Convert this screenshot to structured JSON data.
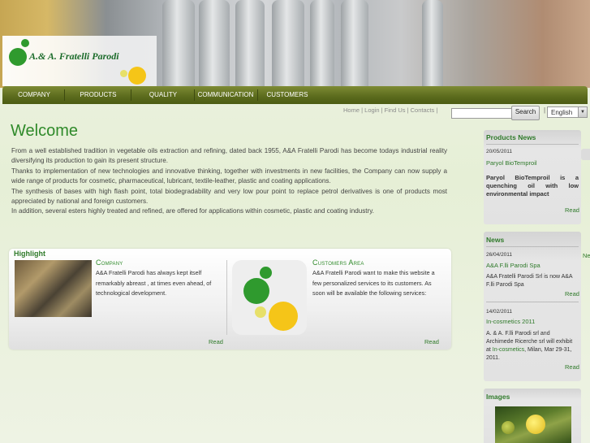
{
  "brand": {
    "logo_text": "A.& A. Fratelli Parodi",
    "colors": {
      "green": "#2f9a2e",
      "yellow": "#f5c518"
    }
  },
  "nav": {
    "items": [
      "COMPANY",
      "PRODUCTS",
      "QUALITY",
      "COMMUNICATION",
      "CUSTOMERS"
    ]
  },
  "toplinks": {
    "home": "Home",
    "login": "Login",
    "findus": "Find Us",
    "contacts": "Contacts"
  },
  "search": {
    "value": "",
    "button": "Search"
  },
  "language": {
    "selected": "English"
  },
  "welcome": {
    "title": "Welcome",
    "p1": "From a well established tradition in vegetable oils extraction and refining, dated back 1955, A&A Fratelli Parodi has become todays industrial reality diversifying its production to gain its present structure.",
    "p2": "Thanks to implementation of new technologies and innovative thinking, together with investments in new facilities, the Company can now supply a wide range of products for cosmetic, pharmaceutical, lubricant, textile-leather, plastic and coating applications.",
    "p3": "The synthesis of bases with high flash point, total biodegradability and very low pour point to replace petrol derivatives is one of products most appreciated by national and foreign customers.",
    "p4": "In addition, several esters highly treated and refined, are offered for applications within cosmetic, plastic and coating  industry."
  },
  "highlight": {
    "title": "Highlight",
    "company": {
      "heading": "Company",
      "body": "A&A Fratelli Parodi has always kept itself remarkably abreast , at times even ahead, of technological development.",
      "read": "Read"
    },
    "customers": {
      "heading": "Customers Area",
      "body": "A&A Fratelli Parodi want to make this website a few personalized services to its customers. As soon will be available the following services:",
      "read": "Read"
    }
  },
  "products_news": {
    "title": "Products News",
    "date": "20/05/2011",
    "link": "Paryol BioTemproil",
    "text": "Paryol BioTemproil is a quenching oil with low environmental impact",
    "read": "Read"
  },
  "news": {
    "title": "News",
    "items": [
      {
        "date": "26/04/2011",
        "link": "A&A F.lli Parodi Spa",
        "text": "A&A Fratelli Parodi Srl is now A&A F.lli Parodi Spa",
        "read": "Read"
      },
      {
        "date": "14/02/2011",
        "link": "In-cosmetics 2011",
        "text_a": "A. & A. F.lli Parodi srl and Archimede Ricerche srl will exhibit at ",
        "text_b": "In-cosmetics",
        "text_c": ", Milan, Mar 29-31, 2011.",
        "read": "Read"
      }
    ],
    "side_stub": "Ne"
  },
  "images": {
    "title": "Images"
  }
}
